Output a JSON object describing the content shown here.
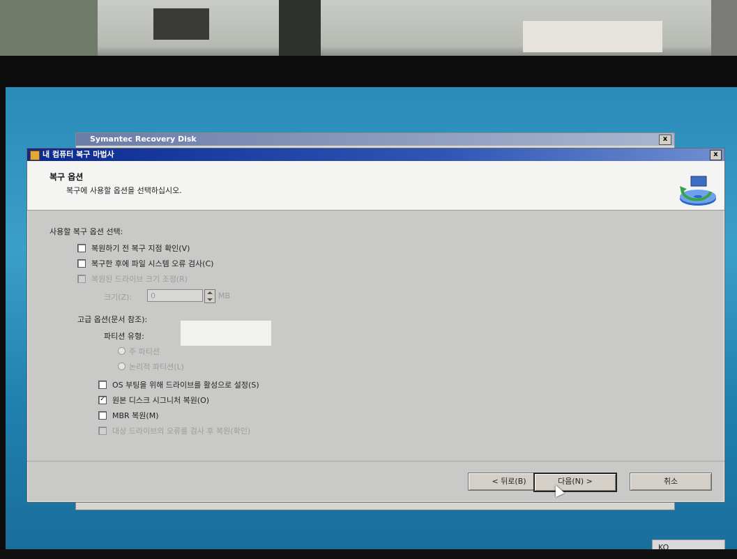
{
  "background_window": {
    "title": "Symantec Recovery Disk",
    "close_label": "x"
  },
  "dialog": {
    "title": "내 컴퓨터 복구 마법사",
    "close_label": "x",
    "header": {
      "title": "복구 옵션",
      "subtitle": "복구에 사용할 옵션을 선택하십시오."
    },
    "section_label": "사용할 복구 옵션 선택:",
    "options": [
      {
        "label": "복원하기 전 복구 지점 확인(V)",
        "checked": false,
        "enabled": true
      },
      {
        "label": "복구한 후에 파일 시스템 오류 검사(C)",
        "checked": false,
        "enabled": true
      },
      {
        "label": "복원된 드라이브 크기 조정(R)",
        "checked": false,
        "enabled": false
      }
    ],
    "size": {
      "label": "크기(Z):",
      "value": "0",
      "unit": "MB"
    },
    "advanced_label": "고급 옵션(문서 참조):",
    "partition_type_label": "파티션 유형:",
    "partition_options": [
      {
        "label": "주 파티션",
        "selected": true
      },
      {
        "label": "논리적 파티션(L)",
        "selected": false
      }
    ],
    "advanced_options": [
      {
        "label": "OS 부팅을 위해 드라이브를 활성으로 설정(S)",
        "checked": false,
        "enabled": true
      },
      {
        "label": "원본 디스크 시그니처 복원(O)",
        "checked": true,
        "enabled": true
      },
      {
        "label": "MBR 복원(M)",
        "checked": false,
        "enabled": true
      },
      {
        "label": "대상 드라이브의 오류를 검사 후 복원(확인)",
        "checked": false,
        "enabled": false
      }
    ],
    "buttons": {
      "back": "< 뒤로(B)",
      "next": "다음(N) >",
      "cancel": "취소"
    }
  },
  "taskbar": {
    "language": "KO"
  },
  "colors": {
    "title_bar": "#0b2a8f",
    "desktop": "#2a8ab8",
    "dialog_body": "#c9c9c7"
  },
  "icons": [
    "app-icon",
    "close-icon",
    "disk-restore-icon",
    "mouse-cursor-icon"
  ]
}
